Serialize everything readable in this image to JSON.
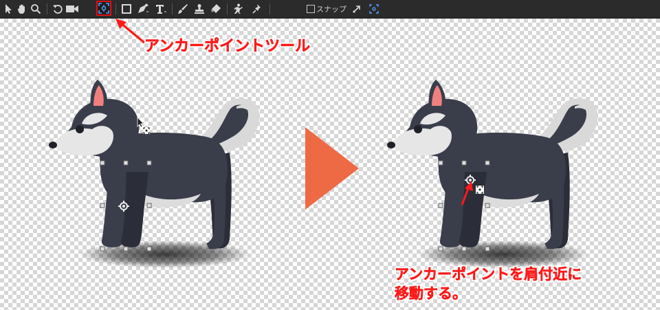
{
  "toolbar": {
    "tools": [
      {
        "name": "select-arrow-icon"
      },
      {
        "name": "hand-icon"
      },
      {
        "name": "zoom-icon"
      },
      {
        "name": "rotate-icon"
      },
      {
        "name": "camera-icon"
      },
      {
        "name": "anchor-point-tool-icon",
        "active": true
      },
      {
        "name": "rectangle-icon"
      },
      {
        "name": "pen-icon"
      },
      {
        "name": "text-icon"
      },
      {
        "name": "brush-icon"
      },
      {
        "name": "stamp-icon"
      },
      {
        "name": "eraser-icon"
      },
      {
        "name": "puppet-pin-icon"
      },
      {
        "name": "pin-icon"
      }
    ],
    "snap_label": "スナップ",
    "snap_checked": false
  },
  "annotations": {
    "tool_callout": "アンカーポイントツール",
    "move_callout_line1": "アンカーポイントを肩付近に",
    "move_callout_line2": "移動する。"
  },
  "colors": {
    "toolbar_bg": "#2b2b2b",
    "highlight_red": "#ff1a1a",
    "arrow_orange": "#ee6a45",
    "dog_body": "#3a3e4b",
    "dog_belly": "#dcdcdc",
    "dog_ear_inner": "#f08080"
  }
}
